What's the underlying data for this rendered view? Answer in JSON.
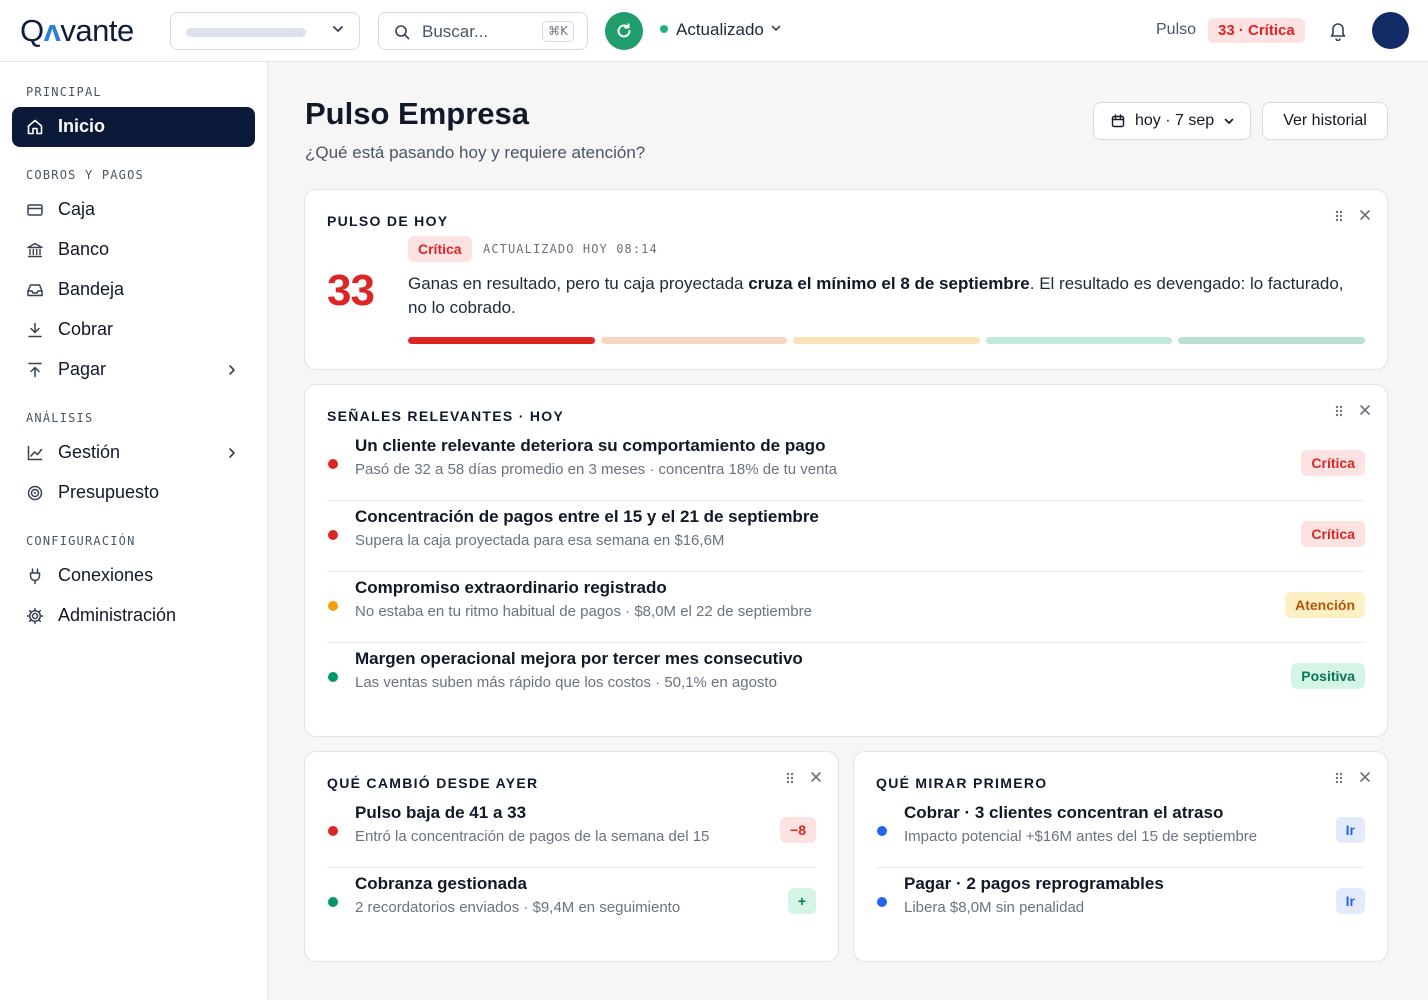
{
  "brand": {
    "logo_q": "Q",
    "logo_a": "ʌ",
    "logo_rest": "vante"
  },
  "header": {
    "search_placeholder": "Buscar...",
    "search_shortcut": "⌘K",
    "status": "Actualizado",
    "pulse_label": "Pulso",
    "pulse_badge": "33 · Crítica",
    "colors": {
      "refresh": "#1f9d6b",
      "status_dot": "#22b07d",
      "avatar": "#142a66"
    }
  },
  "sidebar": {
    "sections": [
      {
        "title": "PRINCIPAL",
        "items": [
          {
            "label": "Inicio",
            "icon": "home-icon",
            "active": true
          }
        ]
      },
      {
        "title": "COBROS Y PAGOS",
        "items": [
          {
            "label": "Caja",
            "icon": "wallet-icon"
          },
          {
            "label": "Banco",
            "icon": "bank-icon"
          },
          {
            "label": "Bandeja",
            "icon": "inbox-icon"
          },
          {
            "label": "Cobrar",
            "icon": "download-icon"
          },
          {
            "label": "Pagar",
            "icon": "upload-icon",
            "has_children": true
          }
        ]
      },
      {
        "title": "ANÁLISIS",
        "items": [
          {
            "label": "Gestión",
            "icon": "chart-line-icon",
            "has_children": true
          },
          {
            "label": "Presupuesto",
            "icon": "target-icon"
          }
        ]
      },
      {
        "title": "CONFIGURACIÓN",
        "items": [
          {
            "label": "Conexiones",
            "icon": "plug-icon"
          },
          {
            "label": "Administración",
            "icon": "gear-icon"
          }
        ]
      }
    ]
  },
  "page": {
    "title": "Pulso Empresa",
    "subtitle": "¿Qué está pasando hoy y requiere atención?",
    "date_button": "hoy · 7 sep",
    "history_button": "Ver historial"
  },
  "pulse_card": {
    "title": "PULSO DE HOY",
    "score": "33",
    "level": "Crítica",
    "updated": "ACTUALIZADO HOY 08:14",
    "text_before": "Ganas en resultado, pero tu caja proyectada ",
    "text_bold": "cruza el mínimo el 8 de septiembre",
    "text_after": ". El resultado es devengado: lo facturado, no lo cobrado.",
    "scale_colors": [
      "#dc2626",
      "#f9d6bf",
      "#f8e2b3",
      "#bfe9d9",
      "#b9e2d2"
    ],
    "active_segment": 0
  },
  "signals": {
    "title": "SEÑALES RELEVANTES · HOY",
    "items": [
      {
        "title": "Un cliente relevante deteriora su comportamiento de pago",
        "sub": "Pasó de 32 a 58 días promedio en 3 meses · concentra 18% de tu venta",
        "tag": "Crítica",
        "tone": "crit",
        "dot": "#dc2626"
      },
      {
        "title": "Concentración de pagos entre el 15 y el 21 de septiembre",
        "sub": "Supera la caja proyectada para esa semana en $16,6M",
        "tag": "Crítica",
        "tone": "crit",
        "dot": "#dc2626"
      },
      {
        "title": "Compromiso extraordinario registrado",
        "sub": "No estaba en tu ritmo habitual de pagos · $8,0M el 22 de septiembre",
        "tag": "Atención",
        "tone": "warn",
        "dot": "#f59e0b"
      },
      {
        "title": "Margen operacional mejora por tercer mes consecutivo",
        "sub": "Las ventas suben más rápido que los costos · 50,1% en agosto",
        "tag": "Positiva",
        "tone": "pos",
        "dot": "#059669"
      }
    ]
  },
  "changes": {
    "title": "QUÉ CAMBIÓ DESDE AYER",
    "items": [
      {
        "title": "Pulso baja de 41 a 33",
        "sub": "Entró la concentración de pagos de la semana del 15",
        "tag": "−8",
        "tone": "neg",
        "dot": "#dc2626"
      },
      {
        "title": "Cobranza gestionada",
        "sub": "2 recordatorios enviados · $9,4M en seguimiento",
        "tag": "+",
        "tone": "plus",
        "dot": "#059669"
      }
    ]
  },
  "first": {
    "title": "QUÉ MIRAR PRIMERO",
    "items": [
      {
        "title": "Cobrar · 3 clientes concentran el atraso",
        "sub": "Impacto potencial +$16M antes del 15 de septiembre",
        "tag": "Ir",
        "tone": "go",
        "dot": "#2563eb"
      },
      {
        "title": "Pagar · 2 pagos reprogramables",
        "sub": "Libera $8,0M sin penalidad",
        "tag": "Ir",
        "tone": "go",
        "dot": "#2563eb"
      }
    ]
  }
}
